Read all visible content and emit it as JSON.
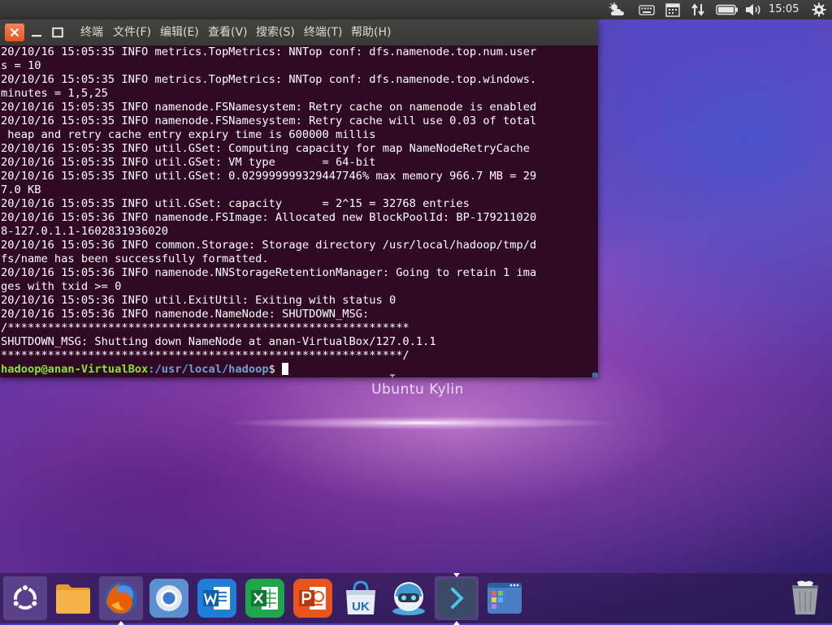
{
  "top_panel": {
    "clock": "15:05",
    "tray_icons": [
      "weather-icon",
      "keyboard-icon",
      "calendar-icon",
      "network-arrows-icon",
      "battery-icon",
      "volume-icon",
      "settings-gear-icon"
    ]
  },
  "terminal": {
    "menu": [
      "终端",
      "文件(F)",
      "编辑(E)",
      "查看(V)",
      "搜索(S)",
      "终端(T)",
      "帮助(H)"
    ],
    "lines": [
      "20/10/16 15:05:35 INFO metrics.TopMetrics: NNTop conf: dfs.namenode.top.num.user",
      "s = 10",
      "20/10/16 15:05:35 INFO metrics.TopMetrics: NNTop conf: dfs.namenode.top.windows.",
      "minutes = 1,5,25",
      "20/10/16 15:05:35 INFO namenode.FSNamesystem: Retry cache on namenode is enabled",
      "20/10/16 15:05:35 INFO namenode.FSNamesystem: Retry cache will use 0.03 of total",
      " heap and retry cache entry expiry time is 600000 millis",
      "20/10/16 15:05:35 INFO util.GSet: Computing capacity for map NameNodeRetryCache",
      "20/10/16 15:05:35 INFO util.GSet: VM type       = 64-bit",
      "20/10/16 15:05:35 INFO util.GSet: 0.029999999329447746% max memory 966.7 MB = 29",
      "7.0 KB",
      "20/10/16 15:05:35 INFO util.GSet: capacity      = 2^15 = 32768 entries",
      "20/10/16 15:05:36 INFO namenode.FSImage: Allocated new BlockPoolId: BP-179211020",
      "8-127.0.1.1-1602831936020",
      "20/10/16 15:05:36 INFO common.Storage: Storage directory /usr/local/hadoop/tmp/d",
      "fs/name has been successfully formatted.",
      "20/10/16 15:05:36 INFO namenode.NNStorageRetentionManager: Going to retain 1 ima",
      "ges with txid >= 0",
      "20/10/16 15:05:36 INFO util.ExitUtil: Exiting with status 0",
      "20/10/16 15:05:36 INFO namenode.NameNode: SHUTDOWN_MSG:",
      "/************************************************************",
      "SHUTDOWN_MSG: Shutting down NameNode at anan-VirtualBox/127.0.1.1",
      "************************************************************/"
    ],
    "prompt": {
      "user": "hadoop@anan-VirtualBox",
      "path": ":/usr/local/hadoop",
      "symbol": "$ "
    }
  },
  "desktop": {
    "wallpaper_label": "Ubuntu Kylin"
  },
  "dock": {
    "items": [
      {
        "name": "ubuntu-kylin-start-icon",
        "running": false,
        "active": false
      },
      {
        "name": "file-manager-folder-icon",
        "running": false,
        "active": false
      },
      {
        "name": "firefox-icon",
        "running": true,
        "active": true
      },
      {
        "name": "chromium-browser-icon",
        "running": false,
        "active": false
      },
      {
        "name": "wps-writer-icon",
        "running": false,
        "active": false
      },
      {
        "name": "wps-spreadsheets-icon",
        "running": false,
        "active": false
      },
      {
        "name": "wps-presentation-icon",
        "running": false,
        "active": false
      },
      {
        "name": "ubuntu-kylin-software-center-icon",
        "running": false,
        "active": false
      },
      {
        "name": "youker-assistant-icon",
        "running": false,
        "active": false
      },
      {
        "name": "terminal-icon",
        "running": true,
        "active": true
      },
      {
        "name": "workspace-switcher-icon",
        "running": false,
        "active": false
      },
      {
        "name": "trash-icon",
        "running": false,
        "active": false
      }
    ],
    "colors": {
      "ubuntu": "#5a3f8a",
      "folder": "#f6b24a",
      "firefox": "#e66000",
      "writer": "#1f7fd6",
      "spreadsheet": "#1fa64a",
      "presentation": "#e8541c"
    }
  }
}
